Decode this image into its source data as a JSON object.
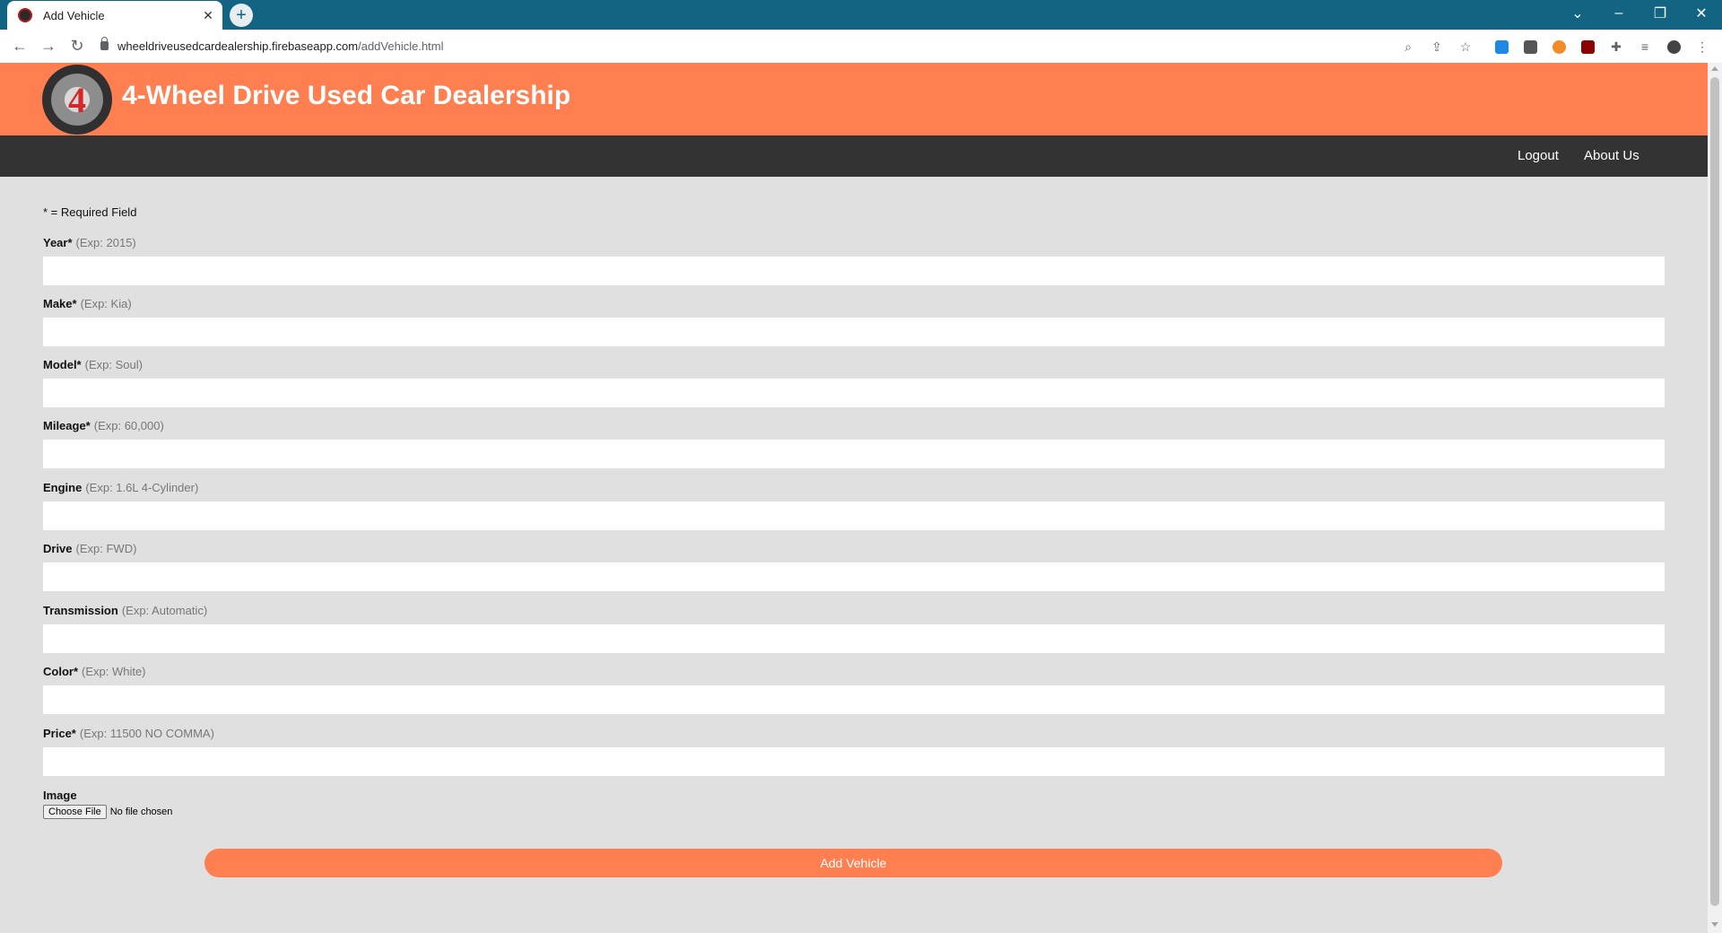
{
  "browser": {
    "tab_title": "Add Vehicle",
    "url_host": "wheeldriveusedcardealership.firebaseapp.com",
    "url_path": "/addVehicle.html"
  },
  "site": {
    "logo_text": "4",
    "title": "4-Wheel Drive Used Car Dealership",
    "nav": [
      "Logout",
      "About Us"
    ]
  },
  "form": {
    "required_note": "* = Required Field",
    "fields": [
      {
        "label": "Year*",
        "example": "(Exp: 2015)",
        "value": ""
      },
      {
        "label": "Make*",
        "example": "(Exp: Kia)",
        "value": ""
      },
      {
        "label": "Model*",
        "example": "(Exp: Soul)",
        "value": ""
      },
      {
        "label": "Mileage*",
        "example": "(Exp: 60,000)",
        "value": ""
      },
      {
        "label": "Engine",
        "example": "(Exp: 1.6L 4-Cylinder)",
        "value": ""
      },
      {
        "label": "Drive",
        "example": "(Exp: FWD)",
        "value": ""
      },
      {
        "label": "Transmission",
        "example": "(Exp: Automatic)",
        "value": ""
      },
      {
        "label": "Color*",
        "example": "(Exp: White)",
        "value": ""
      },
      {
        "label": "Price*",
        "example": "(Exp: 11500 NO COMMA)",
        "value": ""
      }
    ],
    "image_label": "Image",
    "file_button": "Choose File",
    "file_status": "No file chosen",
    "submit_label": "Add Vehicle"
  },
  "colors": {
    "accent": "#ff7f50",
    "nav_bg": "#333333",
    "page_bg": "#e0e0e0",
    "browser_frame": "#136482"
  }
}
